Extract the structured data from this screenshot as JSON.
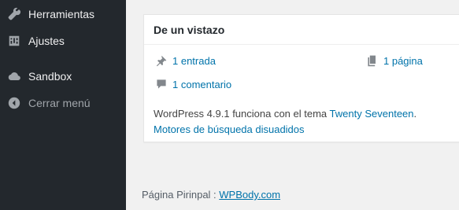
{
  "sidebar": {
    "items": [
      {
        "label": "Herramientas",
        "icon": "wrench-icon"
      },
      {
        "label": "Ajustes",
        "icon": "sliders-icon"
      },
      {
        "label": "Sandbox",
        "icon": "cloud-icon"
      },
      {
        "label": "Cerrar menú",
        "icon": "collapse-arrow-icon"
      }
    ]
  },
  "glance": {
    "title": "De un vistazo",
    "posts": "1 entrada",
    "pages": "1 página",
    "comments": "1 comentario",
    "version_prefix": "WordPress 4.9.1 funciona con el tema ",
    "theme": "Twenty Seventeen",
    "theme_suffix": ".",
    "search_engines": "Motores de búsqueda disuadidos"
  },
  "footer": {
    "prefix": "Página Pirinpal : ",
    "link": "WPBody.com"
  },
  "colors": {
    "sidebar_bg": "#23282d",
    "link": "#0073aa",
    "page_bg": "#f1f1f1"
  }
}
